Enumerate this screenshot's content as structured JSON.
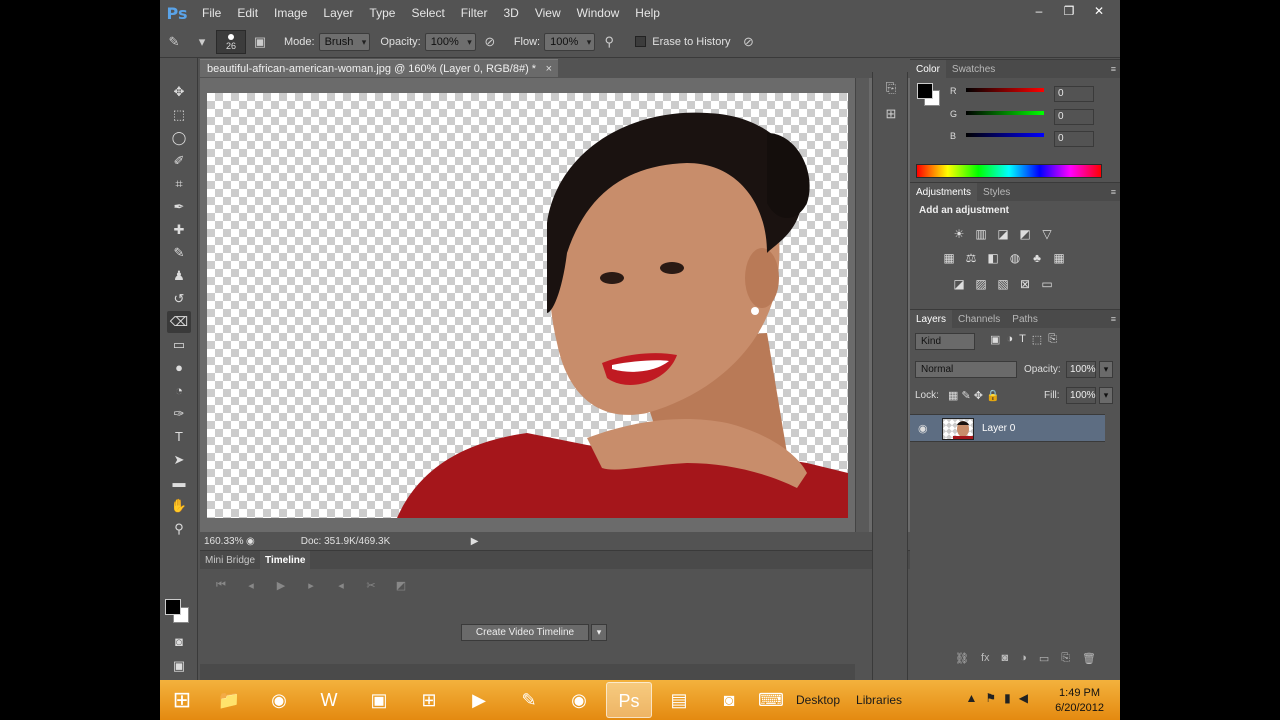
{
  "app": {
    "logo": "Ps",
    "window_controls": [
      "–",
      "❐",
      "✕"
    ]
  },
  "menu": [
    "File",
    "Edit",
    "Image",
    "Layer",
    "Type",
    "Select",
    "Filter",
    "3D",
    "View",
    "Window",
    "Help"
  ],
  "options": {
    "brush_size": "26",
    "mode_label": "Mode:",
    "mode_value": "Brush",
    "opacity_label": "Opacity:",
    "opacity_value": "100%",
    "flow_label": "Flow:",
    "flow_value": "100%",
    "erase_history_label": "Erase to History"
  },
  "document": {
    "tab_title": "beautiful-african-american-woman.jpg @ 160% (Layer 0, RGB/8#) *",
    "tab_close": "×",
    "zoom": "160.33%",
    "doc_size": "Doc: 351.9K/469.3K"
  },
  "timeline": {
    "tabs": [
      "Mini Bridge",
      "Timeline"
    ],
    "create_button": "Create Video Timeline"
  },
  "color_panel": {
    "tabs": [
      "Color",
      "Swatches"
    ],
    "channels": [
      {
        "label": "R",
        "value": "0",
        "color": "#e00000"
      },
      {
        "label": "G",
        "value": "0",
        "color": "#00c000"
      },
      {
        "label": "B",
        "value": "0",
        "color": "#0000e0"
      }
    ]
  },
  "adjustments_panel": {
    "tabs": [
      "Adjustments",
      "Styles"
    ],
    "title": "Add an adjustment"
  },
  "layers_panel": {
    "tabs": [
      "Layers",
      "Channels",
      "Paths"
    ],
    "filter_kind": "Kind",
    "blend_mode": "Normal",
    "opacity_label": "Opacity:",
    "opacity_value": "100%",
    "lock_label": "Lock:",
    "fill_label": "Fill:",
    "fill_value": "100%",
    "layers": [
      {
        "name": "Layer 0",
        "visible": true
      }
    ]
  },
  "taskbar": {
    "desktop_label": "Desktop",
    "libraries_label": "Libraries",
    "time": "1:49 PM",
    "date": "6/20/2012",
    "start_color": "#f0a020"
  },
  "colors": {
    "accent": "#5aa3e8",
    "panel_bg": "#535353",
    "selection": "#5d6d82"
  }
}
